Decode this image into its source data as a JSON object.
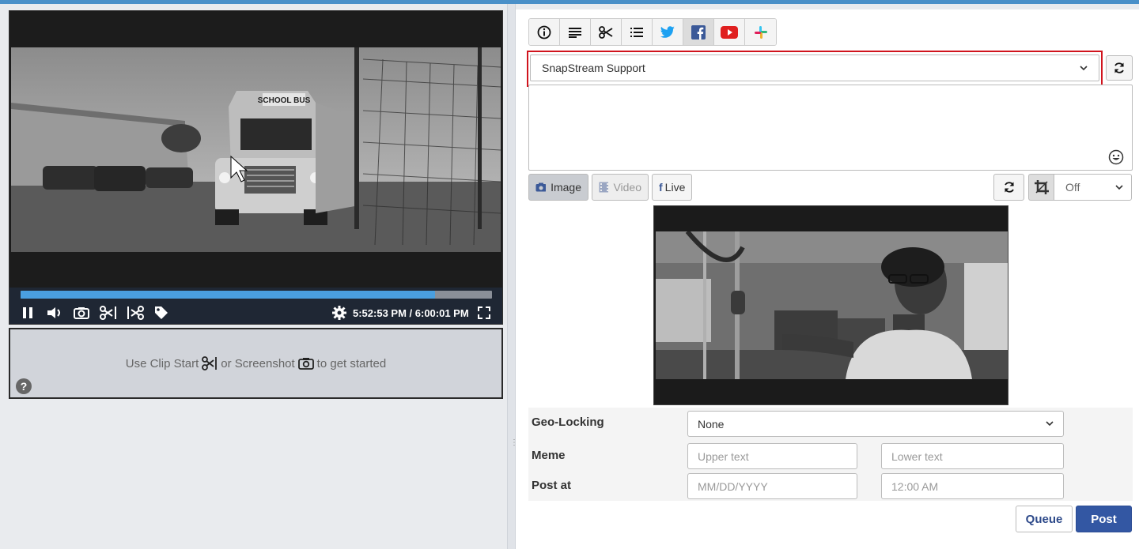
{
  "player": {
    "time_display": "5:52:53 PM  / 6:00:01 PM",
    "progress": 0.88,
    "video_description": "school bus in parking lot",
    "bus_sign": "SCHOOL BUS"
  },
  "clip_hint": {
    "part1": "Use Clip Start",
    "part2": "or Screenshot",
    "part3": "to get started"
  },
  "help_label": "?",
  "tabs": [
    {
      "name": "info-icon"
    },
    {
      "name": "text-icon"
    },
    {
      "name": "scissors-icon"
    },
    {
      "name": "list-icon"
    },
    {
      "name": "twitter-icon"
    },
    {
      "name": "facebook-icon",
      "active": true
    },
    {
      "name": "youtube-icon"
    },
    {
      "name": "slack-icon"
    }
  ],
  "account": {
    "selected": "SnapStream Support"
  },
  "media": {
    "image_label": "Image",
    "video_label": "Video",
    "live_label": "Live"
  },
  "crop": {
    "selected": "Off"
  },
  "form": {
    "geo_label": "Geo-Locking",
    "geo_value": "None",
    "meme_label": "Meme",
    "upper_placeholder": "Upper text",
    "lower_placeholder": "Lower text",
    "post_at_label": "Post at",
    "date_placeholder": "MM/DD/YYYY",
    "time_placeholder": "12:00 AM"
  },
  "actions": {
    "queue_label": "Queue",
    "post_label": "Post"
  },
  "colors": {
    "accent": "#3357a3",
    "progress": "#4a9fe0",
    "highlight": "#d0141d"
  }
}
